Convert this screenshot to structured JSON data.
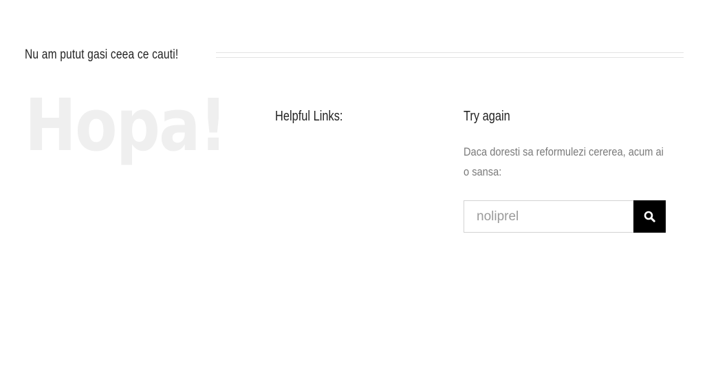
{
  "header": {
    "title": "Nu am putut gasi ceea ce cauti!"
  },
  "hero": {
    "text": "Hopa!"
  },
  "helpful_links": {
    "title": "Helpful Links:"
  },
  "try_again": {
    "title": "Try again",
    "description": "Daca doresti sa reformulezi cererea, acum ai o sansa:",
    "search": {
      "placeholder": "noliprel",
      "value": "",
      "button_icon": "search-icon"
    }
  },
  "colors": {
    "accent_button": "#000000",
    "hero_text": "#efefef",
    "muted_text": "#7a7a7a"
  }
}
